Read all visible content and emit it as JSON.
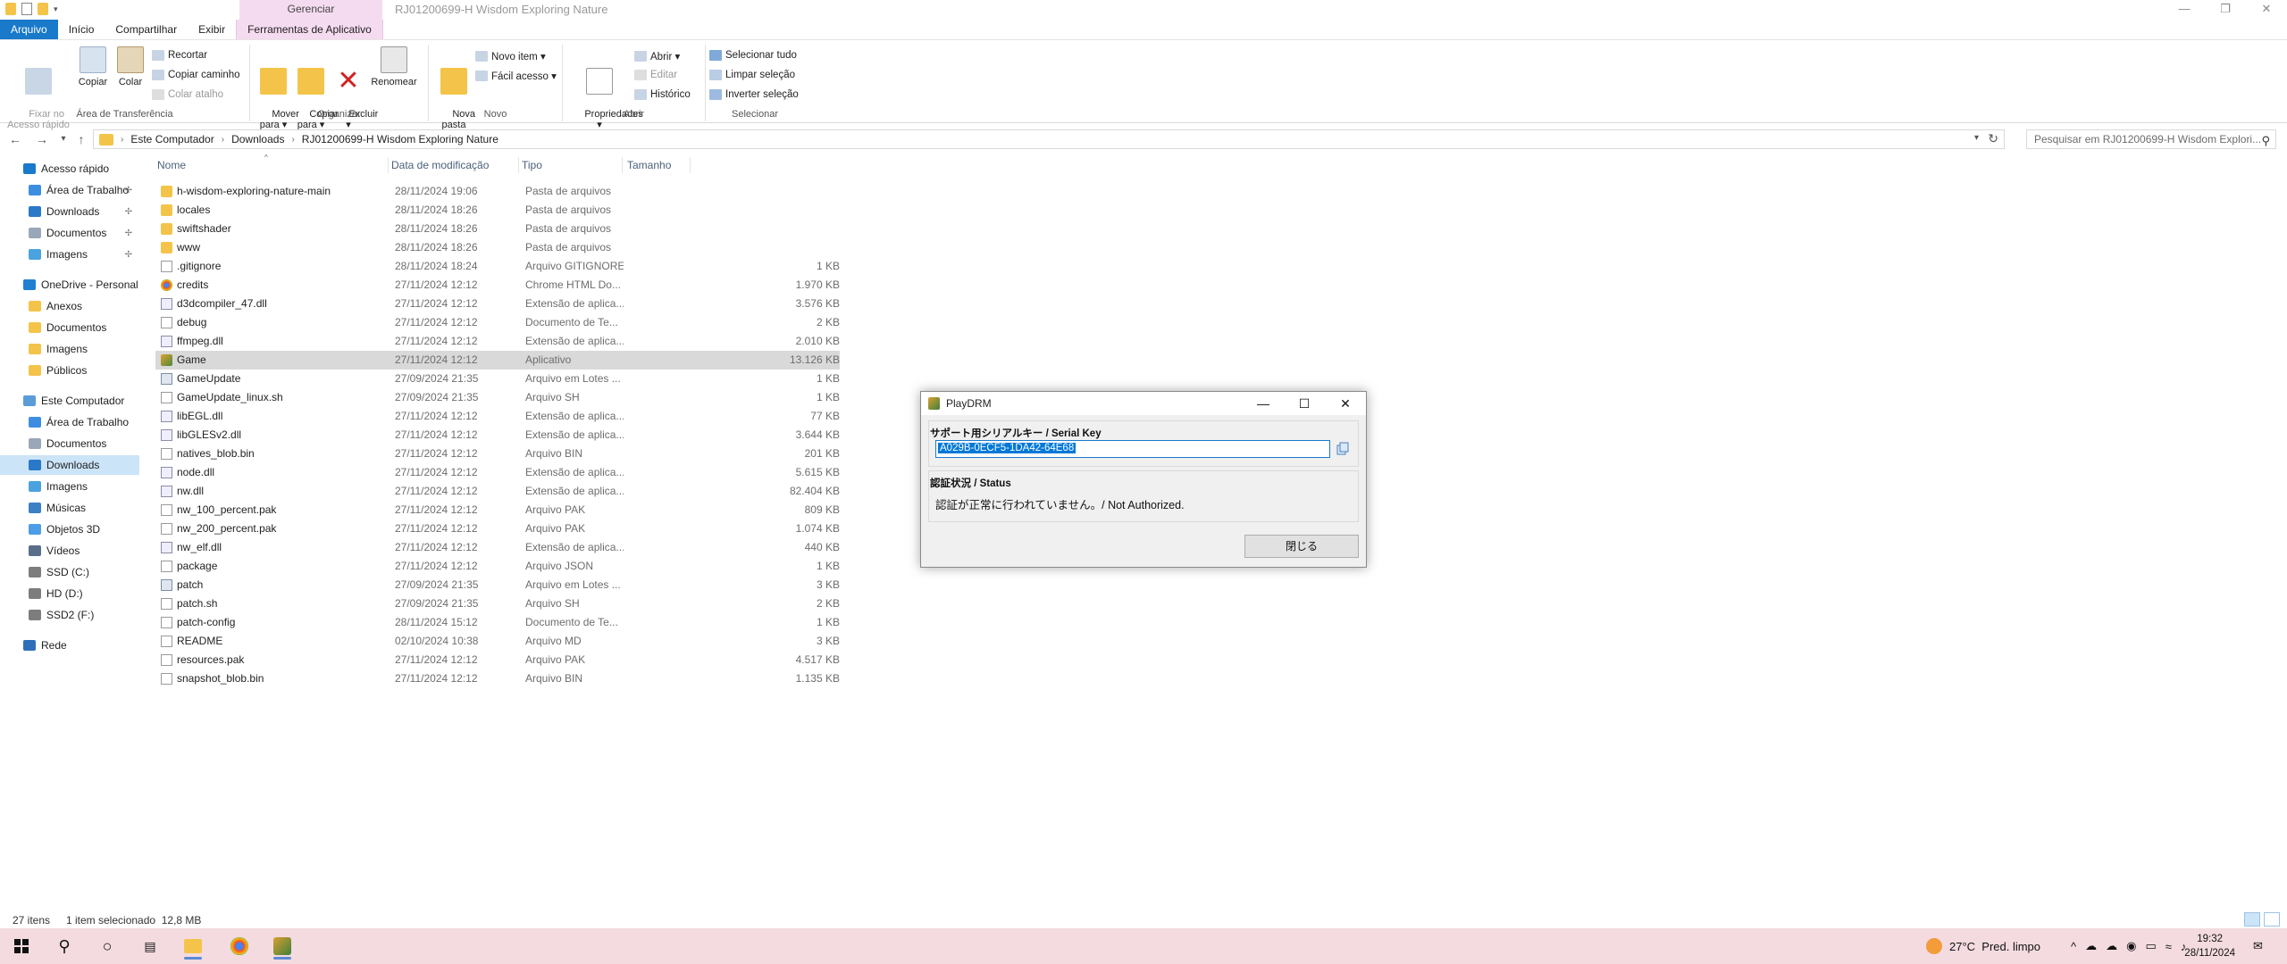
{
  "window": {
    "title": "RJ01200699-H Wisdom Exploring Nature",
    "context_group": "Gerenciar"
  },
  "tabs": [
    "Arquivo",
    "Início",
    "Compartilhar",
    "Exibir",
    "Ferramentas de Aplicativo"
  ],
  "ribbon": {
    "clipboard": {
      "title": "Área de Transferência",
      "pin": "Fixar no\nAcesso rápido",
      "copy": "Copiar",
      "paste": "Colar",
      "cut": "Recortar",
      "copy_path": "Copiar caminho",
      "paste_shortcut": "Colar atalho"
    },
    "organize": {
      "title": "Organizar",
      "move_to": "Mover\npara ▾",
      "copy_to": "Copiar\npara ▾",
      "delete": "Excluir\n▾",
      "rename": "Renomear"
    },
    "new": {
      "title": "Novo",
      "new_folder": "Nova\npasta",
      "new_item": "Novo item ▾",
      "easy_access": "Fácil acesso ▾"
    },
    "open": {
      "title": "Abrir",
      "properties": "Propriedades\n▾",
      "open": "Abrir ▾",
      "edit": "Editar",
      "history": "Histórico"
    },
    "select": {
      "title": "Selecionar",
      "select_all": "Selecionar tudo",
      "select_none": "Limpar seleção",
      "invert": "Inverter seleção"
    }
  },
  "address": {
    "crumbs": [
      "Este Computador",
      "Downloads",
      "RJ01200699-H Wisdom Exploring Nature"
    ],
    "search_placeholder": "Pesquisar em RJ01200699-H Wisdom Explori..."
  },
  "nav": [
    {
      "label": "Acesso rápido",
      "indent": 1,
      "color": "#1979ca",
      "pin": false
    },
    {
      "label": "Área de Trabalho",
      "indent": 2,
      "color": "#3d8ee0",
      "pin": true
    },
    {
      "label": "Downloads",
      "indent": 2,
      "color": "#2a78c8",
      "pin": true
    },
    {
      "label": "Documentos",
      "indent": 2,
      "color": "#9aa7b8",
      "pin": true
    },
    {
      "label": "Imagens",
      "indent": 2,
      "color": "#4aa3df",
      "pin": true
    },
    {
      "label": "OneDrive - Personal",
      "indent": 1,
      "color": "#1f7fd1",
      "pin": false
    },
    {
      "label": "Anexos",
      "indent": 2,
      "color": "#f4c44a",
      "pin": false
    },
    {
      "label": "Documentos",
      "indent": 2,
      "color": "#f4c44a",
      "pin": false
    },
    {
      "label": "Imagens",
      "indent": 2,
      "color": "#f4c44a",
      "pin": false
    },
    {
      "label": "Públicos",
      "indent": 2,
      "color": "#f4c44a",
      "pin": false
    },
    {
      "label": "Este Computador",
      "indent": 1,
      "color": "#5a9bd8",
      "pin": false
    },
    {
      "label": "Área de Trabalho",
      "indent": 2,
      "color": "#3d8ee0",
      "pin": false
    },
    {
      "label": "Documentos",
      "indent": 2,
      "color": "#9aa7b8",
      "pin": false
    },
    {
      "label": "Downloads",
      "indent": 2,
      "color": "#2a78c8",
      "pin": false,
      "selected": true
    },
    {
      "label": "Imagens",
      "indent": 2,
      "color": "#4aa3df",
      "pin": false
    },
    {
      "label": "Músicas",
      "indent": 2,
      "color": "#3b7fc4",
      "pin": false
    },
    {
      "label": "Objetos 3D",
      "indent": 2,
      "color": "#4d9ee6",
      "pin": false
    },
    {
      "label": "Vídeos",
      "indent": 2,
      "color": "#5a6e8a",
      "pin": false
    },
    {
      "label": "SSD (C:)",
      "indent": 2,
      "color": "#7d7d7d",
      "pin": false
    },
    {
      "label": "HD (D:)",
      "indent": 2,
      "color": "#7d7d7d",
      "pin": false
    },
    {
      "label": "SSD2 (F:)",
      "indent": 2,
      "color": "#7d7d7d",
      "pin": false
    },
    {
      "label": "Rede",
      "indent": 1,
      "color": "#2f6fb8",
      "pin": false
    }
  ],
  "columns": {
    "name": "Nome",
    "date": "Data de modificação",
    "type": "Tipo",
    "size": "Tamanho"
  },
  "files": [
    {
      "name": "h-wisdom-exploring-nature-main",
      "date": "28/11/2024 19:06",
      "type": "Pasta de arquivos",
      "size": "",
      "icon": "folder"
    },
    {
      "name": "locales",
      "date": "28/11/2024 18:26",
      "type": "Pasta de arquivos",
      "size": "",
      "icon": "folder"
    },
    {
      "name": "swiftshader",
      "date": "28/11/2024 18:26",
      "type": "Pasta de arquivos",
      "size": "",
      "icon": "folder"
    },
    {
      "name": "www",
      "date": "28/11/2024 18:26",
      "type": "Pasta de arquivos",
      "size": "",
      "icon": "folder"
    },
    {
      "name": ".gitignore",
      "date": "28/11/2024 18:24",
      "type": "Arquivo GITIGNORE",
      "size": "1 KB",
      "icon": "file"
    },
    {
      "name": "credits",
      "date": "27/11/2024 12:12",
      "type": "Chrome HTML Do...",
      "size": "1.970 KB",
      "icon": "chrome"
    },
    {
      "name": "d3dcompiler_47.dll",
      "date": "27/11/2024 12:12",
      "type": "Extensão de aplica...",
      "size": "3.576 KB",
      "icon": "dll"
    },
    {
      "name": "debug",
      "date": "27/11/2024 12:12",
      "type": "Documento de Te...",
      "size": "2 KB",
      "icon": "file"
    },
    {
      "name": "ffmpeg.dll",
      "date": "27/11/2024 12:12",
      "type": "Extensão de aplica...",
      "size": "2.010 KB",
      "icon": "dll"
    },
    {
      "name": "Game",
      "date": "27/11/2024 12:12",
      "type": "Aplicativo",
      "size": "13.126 KB",
      "icon": "app",
      "selected": true
    },
    {
      "name": "GameUpdate",
      "date": "27/09/2024 21:35",
      "type": "Arquivo em Lotes ...",
      "size": "1 KB",
      "icon": "bat"
    },
    {
      "name": "GameUpdate_linux.sh",
      "date": "27/09/2024 21:35",
      "type": "Arquivo SH",
      "size": "1 KB",
      "icon": "file"
    },
    {
      "name": "libEGL.dll",
      "date": "27/11/2024 12:12",
      "type": "Extensão de aplica...",
      "size": "77 KB",
      "icon": "dll"
    },
    {
      "name": "libGLESv2.dll",
      "date": "27/11/2024 12:12",
      "type": "Extensão de aplica...",
      "size": "3.644 KB",
      "icon": "dll"
    },
    {
      "name": "natives_blob.bin",
      "date": "27/11/2024 12:12",
      "type": "Arquivo BIN",
      "size": "201 KB",
      "icon": "file"
    },
    {
      "name": "node.dll",
      "date": "27/11/2024 12:12",
      "type": "Extensão de aplica...",
      "size": "5.615 KB",
      "icon": "dll"
    },
    {
      "name": "nw.dll",
      "date": "27/11/2024 12:12",
      "type": "Extensão de aplica...",
      "size": "82.404 KB",
      "icon": "dll"
    },
    {
      "name": "nw_100_percent.pak",
      "date": "27/11/2024 12:12",
      "type": "Arquivo PAK",
      "size": "809 KB",
      "icon": "file"
    },
    {
      "name": "nw_200_percent.pak",
      "date": "27/11/2024 12:12",
      "type": "Arquivo PAK",
      "size": "1.074 KB",
      "icon": "file"
    },
    {
      "name": "nw_elf.dll",
      "date": "27/11/2024 12:12",
      "type": "Extensão de aplica...",
      "size": "440 KB",
      "icon": "dll"
    },
    {
      "name": "package",
      "date": "27/11/2024 12:12",
      "type": "Arquivo JSON",
      "size": "1 KB",
      "icon": "file"
    },
    {
      "name": "patch",
      "date": "27/09/2024 21:35",
      "type": "Arquivo em Lotes ...",
      "size": "3 KB",
      "icon": "bat"
    },
    {
      "name": "patch.sh",
      "date": "27/09/2024 21:35",
      "type": "Arquivo SH",
      "size": "2 KB",
      "icon": "file"
    },
    {
      "name": "patch-config",
      "date": "28/11/2024 15:12",
      "type": "Documento de Te...",
      "size": "1 KB",
      "icon": "file"
    },
    {
      "name": "README",
      "date": "02/10/2024 10:38",
      "type": "Arquivo MD",
      "size": "3 KB",
      "icon": "file"
    },
    {
      "name": "resources.pak",
      "date": "27/11/2024 12:12",
      "type": "Arquivo PAK",
      "size": "4.517 KB",
      "icon": "file"
    },
    {
      "name": "snapshot_blob.bin",
      "date": "27/11/2024 12:12",
      "type": "Arquivo BIN",
      "size": "1.135 KB",
      "icon": "file"
    }
  ],
  "status": {
    "count": "27 itens",
    "selection": "1 item selecionado  12,8 MB"
  },
  "dialog": {
    "title": "PlayDRM",
    "serial_label": "サポート用シリアルキー / Serial Key",
    "serial_value": "A029B-0ECF5-1DA42-64E68",
    "status_label": "認証状況 / Status",
    "status_text": "認証が正常に行われていません。/ Not Authorized.",
    "close_label": "閉じる"
  },
  "taskbar": {
    "weather": "27°C  Pred. limpo",
    "time": "19:32",
    "date": "28/11/2024"
  }
}
